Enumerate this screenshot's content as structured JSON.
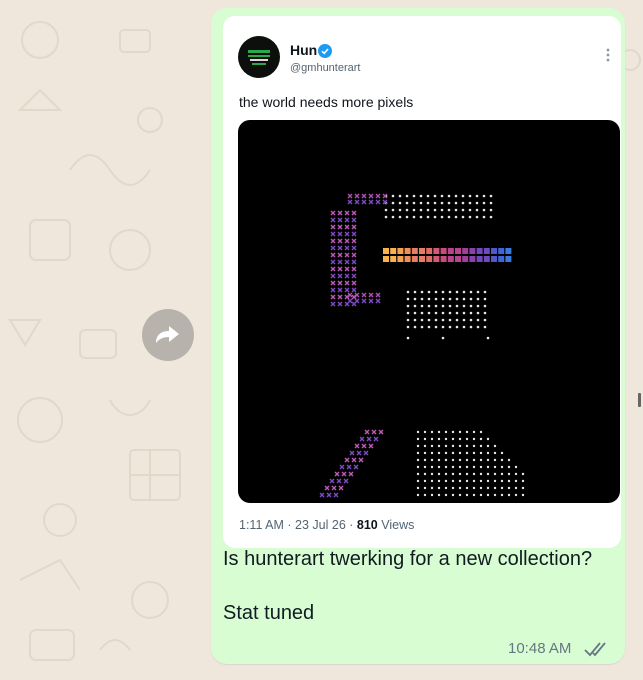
{
  "tweet": {
    "author_name": "Hun",
    "handle": "@gmhunterart",
    "text": "the world needs more pixels",
    "meta_time": "1:11 AM · 23 Jul 26 · ",
    "views_count": "810",
    "views_label": " Views"
  },
  "message": {
    "caption": "Is hunterart twerking for a new collection?\n\nStat tuned",
    "time": "10:48 AM"
  },
  "icons": {
    "forward": "forward-icon",
    "verified": "verified-badge-icon",
    "more": "more-options-icon",
    "read_receipt": "double-check-icon"
  },
  "colors": {
    "bubble": "#d9fdd3",
    "verified": "#1d9bf0",
    "read_ticks": "#667781",
    "wallpaper": "#efe7dc"
  }
}
